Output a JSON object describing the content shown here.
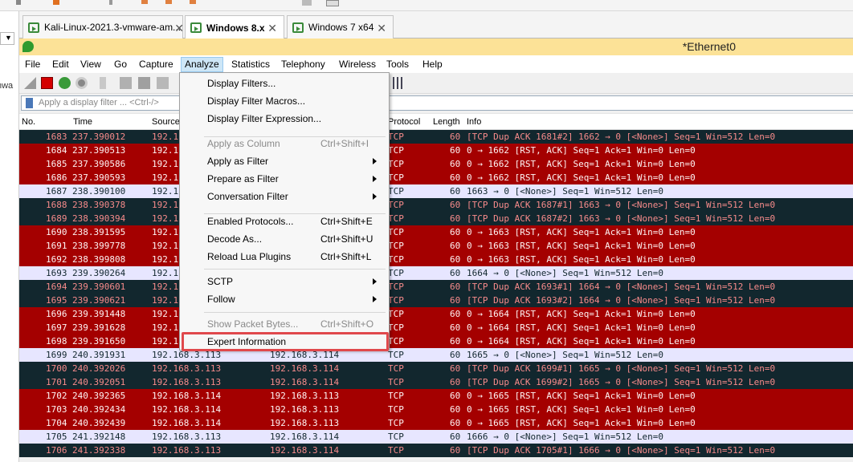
{
  "host": {
    "sidebar_fragment": "nwa"
  },
  "tabs": [
    {
      "label": "Kali-Linux-2021.3-vmware-am...",
      "active": false,
      "close": "✕"
    },
    {
      "label": "Windows 8.x",
      "active": true,
      "close": "✕"
    },
    {
      "label": "Windows 7 x64",
      "active": false,
      "close": "✕"
    }
  ],
  "window": {
    "title": "*Ethernet0"
  },
  "menubar": [
    "File",
    "Edit",
    "View",
    "Go",
    "Capture",
    "Analyze",
    "Statistics",
    "Telephony",
    "Wireless",
    "Tools",
    "Help"
  ],
  "filter": {
    "placeholder": "Apply a display filter ... <Ctrl-/>"
  },
  "columns": [
    "No.",
    "Time",
    "Source",
    "Protocol",
    "Length",
    "Info"
  ],
  "analyze_menu": [
    {
      "label": "Display Filters...",
      "shortcut": "",
      "submenu": false,
      "disabled": false
    },
    {
      "label": "Display Filter Macros...",
      "shortcut": "",
      "submenu": false,
      "disabled": false
    },
    {
      "label": "Display Filter Expression...",
      "shortcut": "",
      "submenu": false,
      "disabled": false
    },
    {
      "label": "Apply as Column",
      "shortcut": "Ctrl+Shift+I",
      "submenu": false,
      "disabled": true
    },
    {
      "label": "Apply as Filter",
      "shortcut": "",
      "submenu": true,
      "disabled": false
    },
    {
      "label": "Prepare as Filter",
      "shortcut": "",
      "submenu": true,
      "disabled": false
    },
    {
      "label": "Conversation Filter",
      "shortcut": "",
      "submenu": true,
      "disabled": false
    },
    {
      "label": "Enabled Protocols...",
      "shortcut": "Ctrl+Shift+E",
      "submenu": false,
      "disabled": false
    },
    {
      "label": "Decode As...",
      "shortcut": "Ctrl+Shift+U",
      "submenu": false,
      "disabled": false
    },
    {
      "label": "Reload Lua Plugins",
      "shortcut": "Ctrl+Shift+L",
      "submenu": false,
      "disabled": false
    },
    {
      "label": "SCTP",
      "shortcut": "",
      "submenu": true,
      "disabled": false
    },
    {
      "label": "Follow",
      "shortcut": "",
      "submenu": true,
      "disabled": false
    },
    {
      "label": "Show Packet Bytes...",
      "shortcut": "Ctrl+Shift+O",
      "submenu": false,
      "disabled": true
    },
    {
      "label": "Expert Information",
      "shortcut": "",
      "submenu": false,
      "disabled": false
    }
  ],
  "packets": [
    {
      "no": "1683",
      "time": "237.390012",
      "src": "192.1",
      "dst": "",
      "proto": "TCP",
      "len": "60",
      "info": "[TCP Dup ACK 1681#2] 1662 → 0 [<None>] Seq=1 Win=512 Len=0",
      "style": "dark"
    },
    {
      "no": "1684",
      "time": "237.390513",
      "src": "192.1",
      "dst": "",
      "proto": "TCP",
      "len": "60",
      "info": "0 → 1662 [RST, ACK] Seq=1 Ack=1 Win=0 Len=0",
      "style": "red"
    },
    {
      "no": "1685",
      "time": "237.390586",
      "src": "192.1",
      "dst": "",
      "proto": "TCP",
      "len": "60",
      "info": "0 → 1662 [RST, ACK] Seq=1 Ack=1 Win=0 Len=0",
      "style": "red"
    },
    {
      "no": "1686",
      "time": "237.390593",
      "src": "192.1",
      "dst": "",
      "proto": "TCP",
      "len": "60",
      "info": "0 → 1662 [RST, ACK] Seq=1 Ack=1 Win=0 Len=0",
      "style": "red"
    },
    {
      "no": "1687",
      "time": "238.390100",
      "src": "192.1",
      "dst": "",
      "proto": "TCP",
      "len": "60",
      "info": "1663 → 0 [<None>] Seq=1 Win=512 Len=0",
      "style": "light"
    },
    {
      "no": "1688",
      "time": "238.390378",
      "src": "192.1",
      "dst": "",
      "proto": "TCP",
      "len": "60",
      "info": "[TCP Dup ACK 1687#1] 1663 → 0 [<None>] Seq=1 Win=512 Len=0",
      "style": "dark"
    },
    {
      "no": "1689",
      "time": "238.390394",
      "src": "192.1",
      "dst": "",
      "proto": "TCP",
      "len": "60",
      "info": "[TCP Dup ACK 1687#2] 1663 → 0 [<None>] Seq=1 Win=512 Len=0",
      "style": "dark"
    },
    {
      "no": "1690",
      "time": "238.391595",
      "src": "192.1",
      "dst": "",
      "proto": "TCP",
      "len": "60",
      "info": "0 → 1663 [RST, ACK] Seq=1 Ack=1 Win=0 Len=0",
      "style": "red"
    },
    {
      "no": "1691",
      "time": "238.399778",
      "src": "192.1",
      "dst": "",
      "proto": "TCP",
      "len": "60",
      "info": "0 → 1663 [RST, ACK] Seq=1 Ack=1 Win=0 Len=0",
      "style": "red"
    },
    {
      "no": "1692",
      "time": "238.399808",
      "src": "192.1",
      "dst": "",
      "proto": "TCP",
      "len": "60",
      "info": "0 → 1663 [RST, ACK] Seq=1 Ack=1 Win=0 Len=0",
      "style": "red"
    },
    {
      "no": "1693",
      "time": "239.390264",
      "src": "192.1",
      "dst": "",
      "proto": "TCP",
      "len": "60",
      "info": "1664 → 0 [<None>] Seq=1 Win=512 Len=0",
      "style": "light"
    },
    {
      "no": "1694",
      "time": "239.390601",
      "src": "192.1",
      "dst": "",
      "proto": "TCP",
      "len": "60",
      "info": "[TCP Dup ACK 1693#1] 1664 → 0 [<None>] Seq=1 Win=512 Len=0",
      "style": "dark"
    },
    {
      "no": "1695",
      "time": "239.390621",
      "src": "192.1",
      "dst": "",
      "proto": "TCP",
      "len": "60",
      "info": "[TCP Dup ACK 1693#2] 1664 → 0 [<None>] Seq=1 Win=512 Len=0",
      "style": "dark"
    },
    {
      "no": "1696",
      "time": "239.391448",
      "src": "192.1",
      "dst": "",
      "proto": "TCP",
      "len": "60",
      "info": "0 → 1664 [RST, ACK] Seq=1 Ack=1 Win=0 Len=0",
      "style": "red"
    },
    {
      "no": "1697",
      "time": "239.391628",
      "src": "192.1",
      "dst": "",
      "proto": "TCP",
      "len": "60",
      "info": "0 → 1664 [RST, ACK] Seq=1 Ack=1 Win=0 Len=0",
      "style": "red"
    },
    {
      "no": "1698",
      "time": "239.391650",
      "src": "192.1",
      "dst": "",
      "proto": "TCP",
      "len": "60",
      "info": "0 → 1664 [RST, ACK] Seq=1 Ack=1 Win=0 Len=0",
      "style": "red"
    },
    {
      "no": "1699",
      "time": "240.391931",
      "src": "192.168.3.113",
      "dst": "192.168.3.114",
      "proto": "TCP",
      "len": "60",
      "info": "1665 → 0 [<None>] Seq=1 Win=512 Len=0",
      "style": "light"
    },
    {
      "no": "1700",
      "time": "240.392026",
      "src": "192.168.3.113",
      "dst": "192.168.3.114",
      "proto": "TCP",
      "len": "60",
      "info": "[TCP Dup ACK 1699#1] 1665 → 0 [<None>] Seq=1 Win=512 Len=0",
      "style": "dark"
    },
    {
      "no": "1701",
      "time": "240.392051",
      "src": "192.168.3.113",
      "dst": "192.168.3.114",
      "proto": "TCP",
      "len": "60",
      "info": "[TCP Dup ACK 1699#2] 1665 → 0 [<None>] Seq=1 Win=512 Len=0",
      "style": "dark"
    },
    {
      "no": "1702",
      "time": "240.392365",
      "src": "192.168.3.114",
      "dst": "192.168.3.113",
      "proto": "TCP",
      "len": "60",
      "info": "0 → 1665 [RST, ACK] Seq=1 Ack=1 Win=0 Len=0",
      "style": "red"
    },
    {
      "no": "1703",
      "time": "240.392434",
      "src": "192.168.3.114",
      "dst": "192.168.3.113",
      "proto": "TCP",
      "len": "60",
      "info": "0 → 1665 [RST, ACK] Seq=1 Ack=1 Win=0 Len=0",
      "style": "red"
    },
    {
      "no": "1704",
      "time": "240.392439",
      "src": "192.168.3.114",
      "dst": "192.168.3.113",
      "proto": "TCP",
      "len": "60",
      "info": "0 → 1665 [RST, ACK] Seq=1 Ack=1 Win=0 Len=0",
      "style": "red"
    },
    {
      "no": "1705",
      "time": "241.392148",
      "src": "192.168.3.113",
      "dst": "192.168.3.114",
      "proto": "TCP",
      "len": "60",
      "info": "1666 → 0 [<None>] Seq=1 Win=512 Len=0",
      "style": "light"
    },
    {
      "no": "1706",
      "time": "241.392338",
      "src": "192.168.3.113",
      "dst": "192.168.3.114",
      "proto": "TCP",
      "len": "60",
      "info": "[TCP Dup ACK 1705#1] 1666 → 0 [<None>] Seq=1 Win=512 Len=0",
      "style": "dark"
    }
  ],
  "colors": {
    "row_dark_bg": "#12272e",
    "row_red_bg": "#a40000",
    "row_light_bg": "#e7e6ff",
    "titlebar_bg": "#fce297",
    "highlight_box": "#e0484c"
  }
}
